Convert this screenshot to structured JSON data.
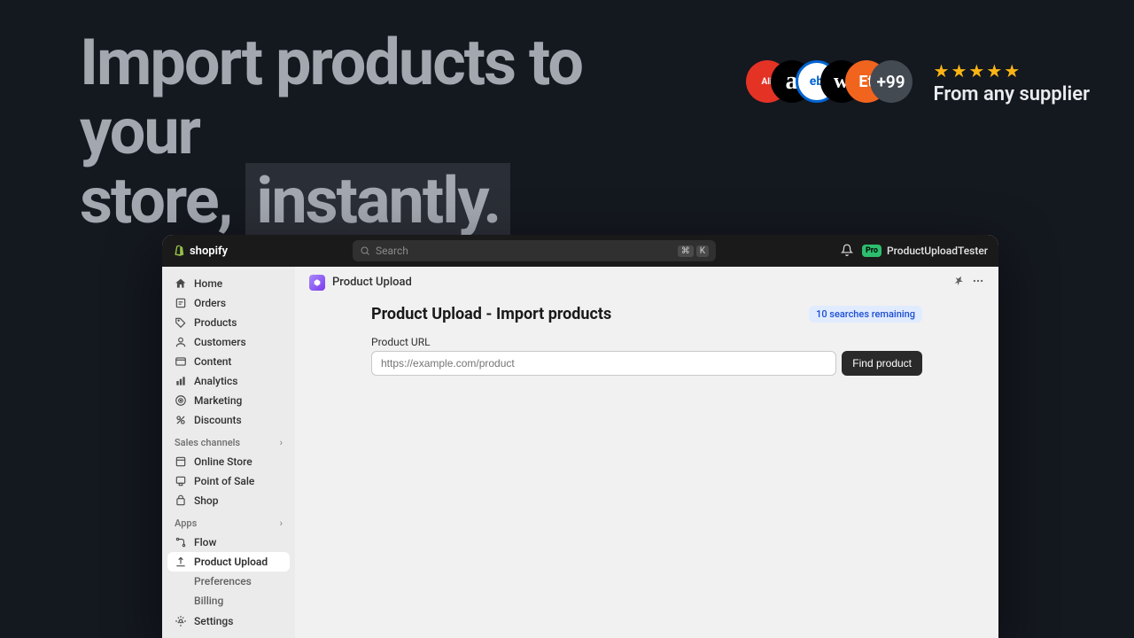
{
  "hero": {
    "line1": "Import products to your",
    "line2_a": "store,",
    "line2_b": "instantly."
  },
  "suppliers": {
    "more_label": "+99",
    "text": "From any supplier"
  },
  "topbar": {
    "brand": "shopify",
    "search_placeholder": "Search",
    "shortcut1": "⌘",
    "shortcut2": "K",
    "pro": "Pro",
    "user": "ProductUploadTester"
  },
  "sidebar": {
    "main": [
      {
        "label": "Home"
      },
      {
        "label": "Orders"
      },
      {
        "label": "Products"
      },
      {
        "label": "Customers"
      },
      {
        "label": "Content"
      },
      {
        "label": "Analytics"
      },
      {
        "label": "Marketing"
      },
      {
        "label": "Discounts"
      }
    ],
    "section_channels": "Sales channels",
    "channels": [
      {
        "label": "Online Store"
      },
      {
        "label": "Point of Sale"
      },
      {
        "label": "Shop"
      }
    ],
    "section_apps": "Apps",
    "apps": [
      {
        "label": "Flow"
      },
      {
        "label": "Product Upload"
      },
      {
        "label": "Preferences"
      },
      {
        "label": "Billing"
      }
    ],
    "settings": "Settings"
  },
  "page": {
    "app_name": "Product Upload",
    "title": "Product Upload - Import products",
    "badge": "10 searches remaining",
    "url_label": "Product URL",
    "url_placeholder": "https://example.com/product",
    "find_btn": "Find product"
  }
}
